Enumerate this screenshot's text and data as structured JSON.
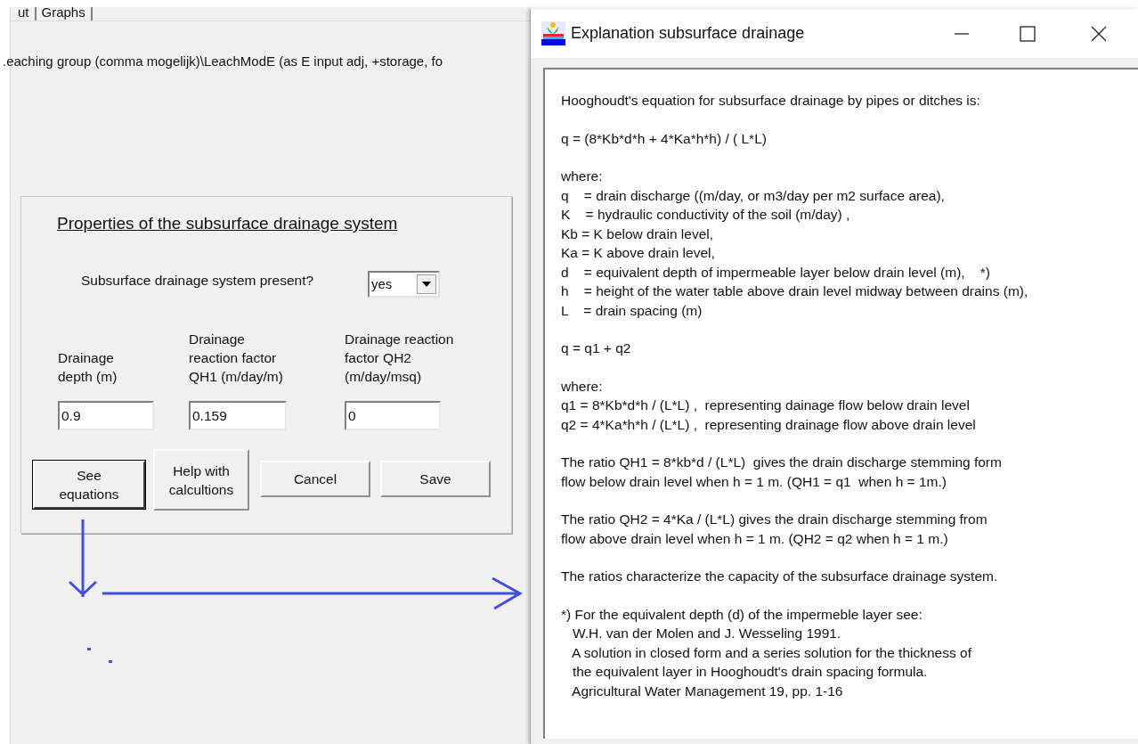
{
  "main_window": {
    "tabs": [
      {
        "label": "ut"
      },
      {
        "label": "Graphs"
      }
    ],
    "path_text": ".eaching group (comma mogelijk)\\LeachModE (as E input adj, +storage, fo",
    "panel": {
      "title": "Properties of the subsurface drainage system",
      "question": "Subsurface drainage system present?",
      "dropdown": {
        "value": "yes"
      },
      "fields": [
        {
          "label": "Drainage depth (m)",
          "value": "0.9"
        },
        {
          "label": "Drainage reaction factor QH1 (m/day/m)",
          "value": "0.159"
        },
        {
          "label": "Drainage reaction factor QH2 (m/day/msq)",
          "value": "0"
        }
      ],
      "buttons": [
        {
          "label": "See equations",
          "default": true
        },
        {
          "label": "Help with calcultions",
          "default": false
        },
        {
          "label": "Cancel",
          "default": false
        },
        {
          "label": "Save",
          "default": false
        }
      ]
    }
  },
  "explanation_window": {
    "title": "Explanation subsurface drainage",
    "paragraphs": [
      [
        "Hooghoudt's equation for subsurface drainage by pipes or ditches is:"
      ],
      [
        "q = (8*Kb*d*h + 4*Ka*h*h) / ( L*L)"
      ],
      [
        "where:",
        "q    = drain discharge ((m/day, or m3/day per m2 surface area),",
        "K    = hydraulic conductivity of the soil (m/day) ,",
        "Kb = K below drain level,",
        "Ka = K above drain level,",
        "d    = equivalent depth of impermeable layer below drain level (m),    *)",
        "h    = height of the water table above drain level midway between drains (m),",
        "L    = drain spacing (m)"
      ],
      [
        "q = q1 + q2"
      ],
      [
        "where:",
        "q1 = 8*Kb*d*h / (L*L) ,  representing dainage flow below drain level",
        "q2 = 4*Ka*h*h / (L*L) ,  representing drainage flow above drain level"
      ],
      [
        "The ratio QH1 = 8*kb*d / (L*L)  gives the drain discharge stemming form",
        "flow below drain level when h = 1 m. (QH1 = q1  when h = 1m.)"
      ],
      [
        "The ratio QH2 = 4*Ka / (L*L) gives the drain discharge stemming from",
        "flow above drain level when h = 1 m. (QH2 = q2 when h = 1 m.)"
      ],
      [
        "The ratios characterize the capacity of the subsurface drainage system."
      ],
      [
        "*) For the equivalent depth (d) of the impermeble layer see:",
        "   W.H. van der Molen and J. Wesseling 1991.",
        "   A solution in closed form and a series solution for the thickness of",
        "   the equivalent layer in Hooghoudt's drain spacing formula.",
        "   Agricultural Water Management 19, pp. 1-16"
      ]
    ]
  }
}
